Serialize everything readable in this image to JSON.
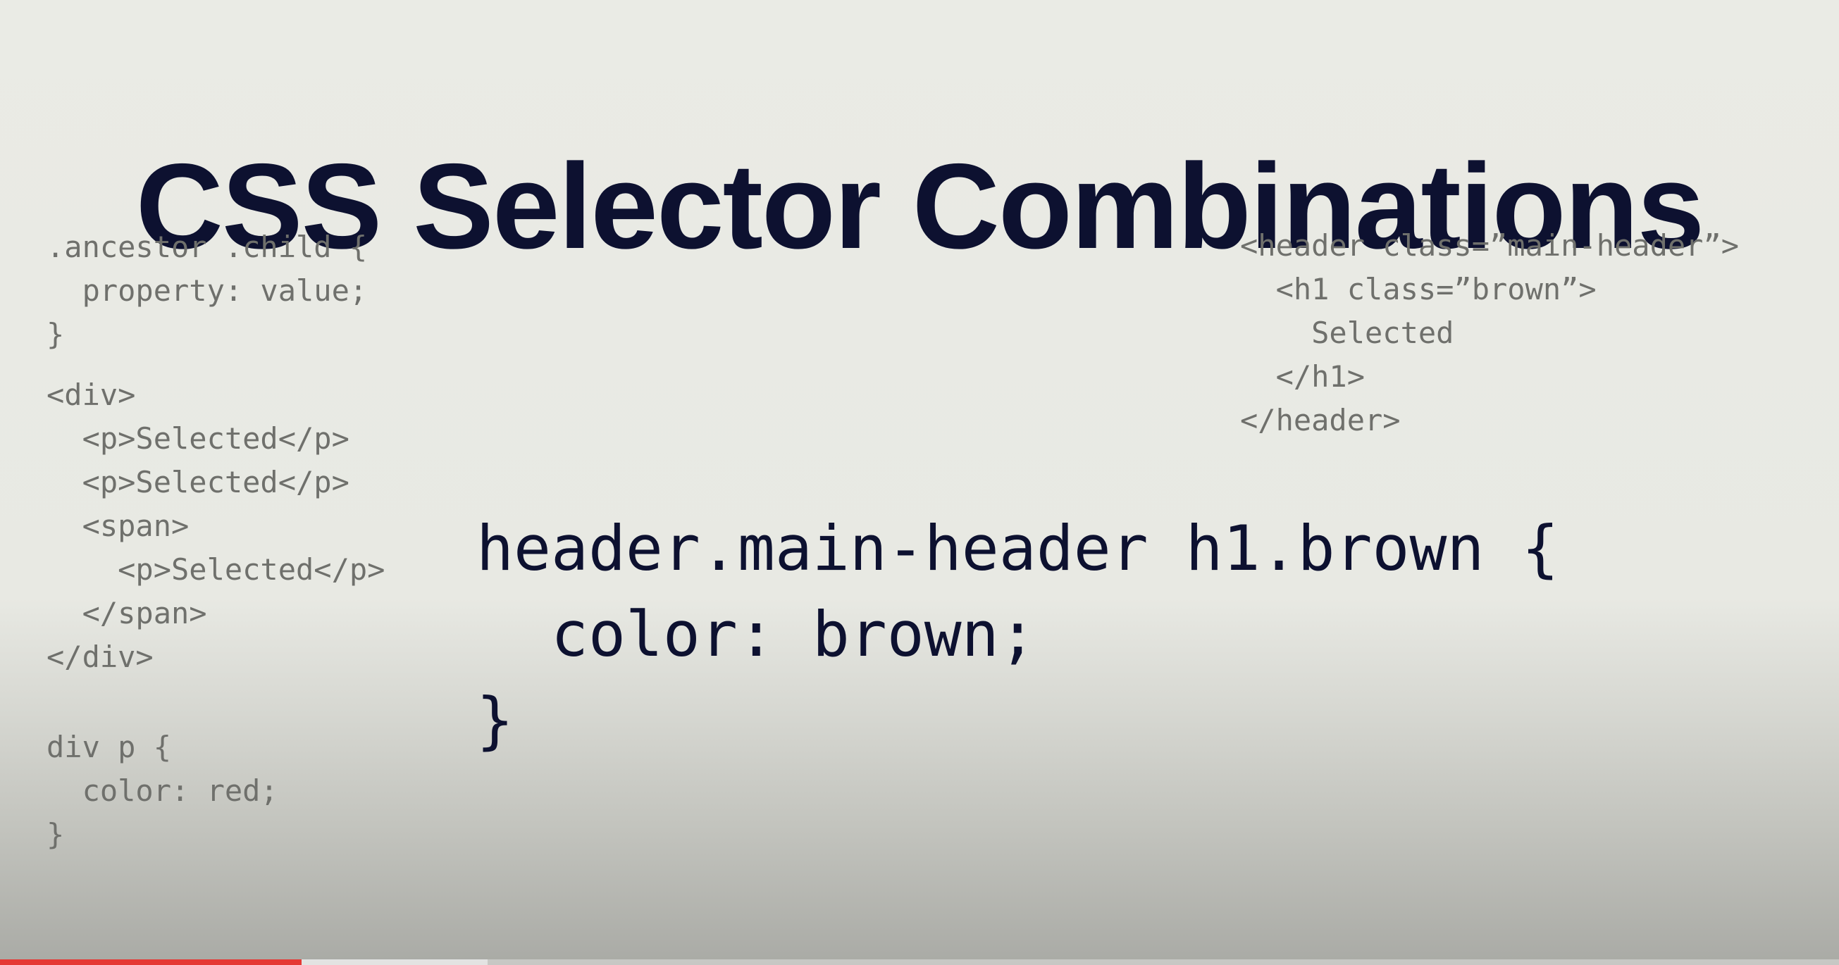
{
  "slide": {
    "title": "CSS Selector Combinations",
    "syntax_example": ".ancestor .child {\n  property: value;\n}",
    "html_example": "<div>\n  <p>Selected</p>\n  <p>Selected</p>\n  <span>\n    <p>Selected</p>\n  </span>\n</div>",
    "css_rule_example": "div p {\n  color: red;\n}",
    "header_html_example": "<header class=”main-header”>\n  <h1 class=”brown”>\n    Selected\n  </h1>\n</header>",
    "main_rule": "header.main-header h1.brown {\n  color: brown;\n}"
  },
  "colors": {
    "title": "#0d1130",
    "muted_code": "#6f706c",
    "progress_played": "#e53935"
  },
  "video": {
    "progress_played_percent": 16.4,
    "progress_buffered_percent": 26.5
  }
}
